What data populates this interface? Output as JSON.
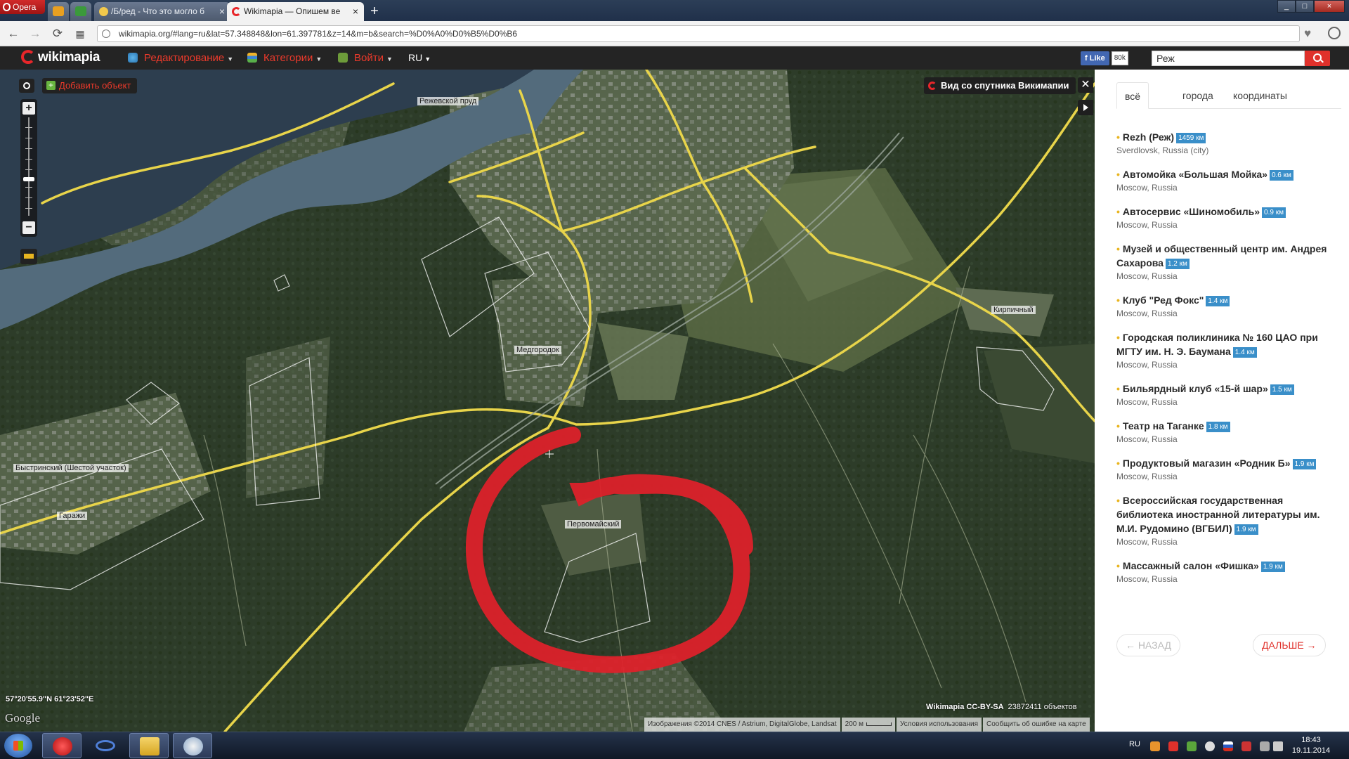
{
  "browser": {
    "menu_label": "Opera",
    "tabs": [
      {
        "title": "/Б/ред - Что это могло б",
        "active": false
      },
      {
        "title": "Wikimapia — Опишем ве",
        "active": true
      }
    ],
    "new_tab": "+",
    "url": "wikimapia.org/#lang=ru&lat=57.348848&lon=61.397781&z=14&m=b&search=%D0%A0%D0%B5%D0%B6"
  },
  "header": {
    "logo": "wikimapia",
    "menu": [
      {
        "label": "Редактирование",
        "icon": "globe-icon"
      },
      {
        "label": "Категории",
        "icon": "categories-icon"
      },
      {
        "label": "Войти",
        "icon": "login-icon"
      }
    ],
    "language": "RU",
    "fb_like": "Like",
    "fb_count": "80k",
    "search_value": "Реж"
  },
  "map": {
    "add_object": "Добавить объект",
    "satellite_view": "Вид со спутника Викимапии",
    "labels": {
      "pond": "Режевской пруд",
      "medgorodok": "Медгородок",
      "kirpichny": "Кирпичный",
      "bystrinsky": "Быстринский (Шестой участок)",
      "garazhi": "Гаражи",
      "pervomaisky": "Первомайский"
    },
    "coordinates": "57°20'55.9\"N 61°23'52\"E",
    "google": "Google",
    "license": "Wikimapia CC-BY-SA",
    "object_count": "23872411 объектов",
    "attribution": "Изображения ©2014 CNES / Astrium, DigitalGlobe, Landsat",
    "scale": "200 м",
    "terms": "Условия использования",
    "report": "Сообщить об ошибке на карте",
    "highlight_color": "#e0202a"
  },
  "sidebar": {
    "tabs": [
      "всё",
      "города",
      "координаты"
    ],
    "results": [
      {
        "title": "Rezh (Реж)",
        "distance": "1459 км",
        "location": "Sverdlovsk, Russia (city)"
      },
      {
        "title": "Автомойка «Большая Мойка»",
        "distance": "0.6 км",
        "location": "Moscow, Russia"
      },
      {
        "title": "Автосервис «Шиномобиль»",
        "distance": "0.9 км",
        "location": "Moscow, Russia"
      },
      {
        "title": "Музей и общественный центр им. Андрея Сахарова",
        "distance": "1.2 км",
        "location": "Moscow, Russia"
      },
      {
        "title": "Клуб \"Ред Фокс\"",
        "distance": "1.4 км",
        "location": "Moscow, Russia"
      },
      {
        "title": "Городская поликлиника № 160 ЦАО при МГТУ им. Н. Э. Баумана",
        "distance": "1.4 км",
        "location": "Moscow, Russia"
      },
      {
        "title": "Бильярдный клуб «15-й шар»",
        "distance": "1.5 км",
        "location": "Moscow, Russia"
      },
      {
        "title": "Театр на Таганке",
        "distance": "1.8 км",
        "location": "Moscow, Russia"
      },
      {
        "title": "Продуктовый магазин «Родник Б»",
        "distance": "1.9 км",
        "location": "Moscow, Russia"
      },
      {
        "title": "Всероссийская государственная библиотека иностранной литературы им. М.И. Рудомино (ВГБИЛ)",
        "distance": "1.9 км",
        "location": "Moscow, Russia"
      },
      {
        "title": "Массажный салон «Фишка»",
        "distance": "1.9 км",
        "location": "Moscow, Russia"
      }
    ],
    "prev": "← НАЗАД",
    "next": "ДАЛЬШЕ →"
  },
  "taskbar": {
    "language": "RU",
    "time": "18:43",
    "date": "19.11.2014"
  }
}
